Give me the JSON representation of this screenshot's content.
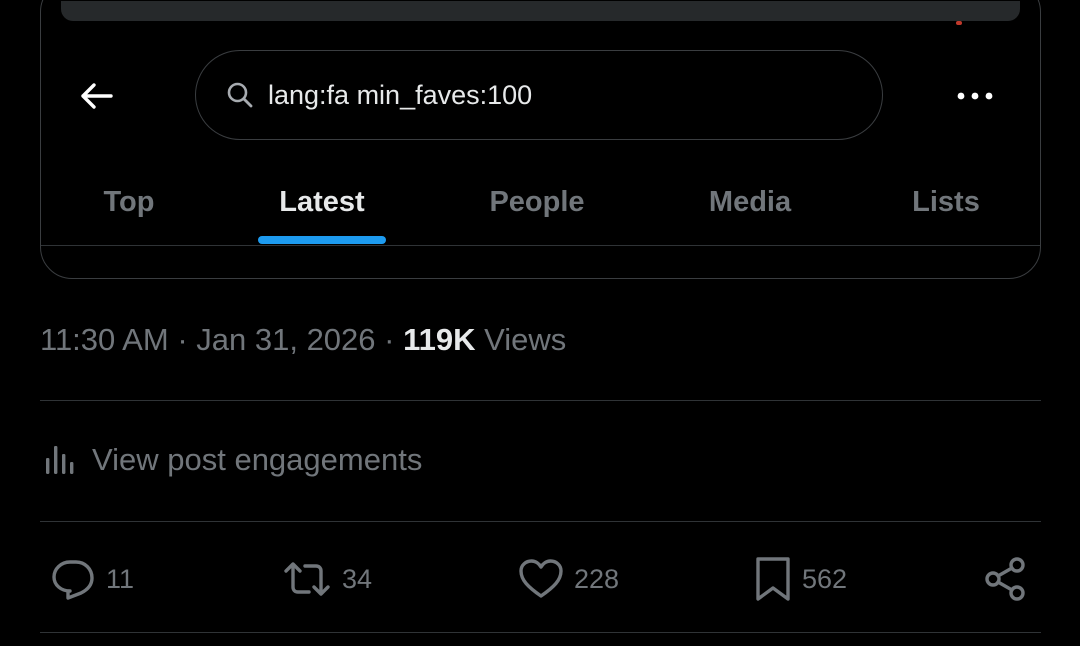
{
  "search": {
    "query": "lang:fa min_faves:100",
    "tabs": [
      "Top",
      "Latest",
      "People",
      "Media",
      "Lists"
    ],
    "active_tab": "Latest"
  },
  "post": {
    "time": "11:30 AM",
    "date": "Jan 31, 2026",
    "separator": "·",
    "views_count": "119K",
    "views_label": "Views",
    "engagements_label": "View post engagements",
    "actions": {
      "replies": "11",
      "reposts": "34",
      "likes": "228",
      "bookmarks": "562"
    }
  },
  "colors": {
    "background": "#000000",
    "text_primary": "#e7e9ea",
    "text_secondary": "#71767b",
    "accent": "#1d9bf0",
    "divider": "#2f3336"
  },
  "icons": {
    "back": "arrow-left-icon",
    "search": "search-icon",
    "more": "more-horizontal-icon",
    "engagements": "bar-chart-icon",
    "reply": "reply-icon",
    "repost": "repost-icon",
    "like": "heart-icon",
    "bookmark": "bookmark-icon",
    "share": "share-icon"
  }
}
